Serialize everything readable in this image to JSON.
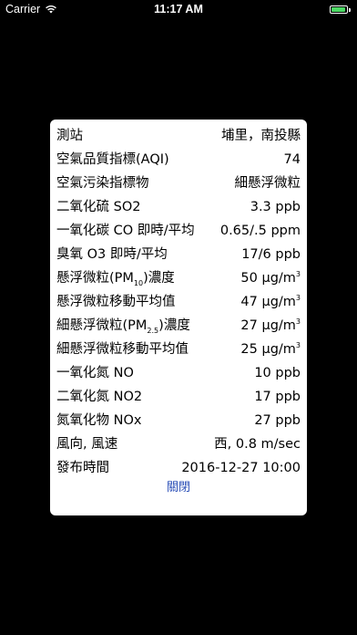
{
  "status_bar": {
    "carrier": "Carrier",
    "time": "11:17 AM",
    "battery_color": "#4cd964",
    "battery_level": 1.0
  },
  "dialog": {
    "rows": [
      {
        "label": "測站",
        "value": "埔里，南投縣"
      },
      {
        "label": "空氣品質指標(AQI)",
        "value": "74"
      },
      {
        "label": "空氣污染指標物",
        "value": "細懸浮微粒"
      },
      {
        "label": "二氧化硫 SO2",
        "value": "3.3 ppb"
      },
      {
        "label": "一氧化碳 CO 即時/平均",
        "value": "0.65/.5 ppm"
      },
      {
        "label": "臭氧 O3 即時/平均",
        "value": "17/6 ppb"
      },
      {
        "label_pre": "懸浮微粒(PM",
        "label_sub": "10",
        "label_post": ")濃度",
        "value_pre": "50 μg/m",
        "value_sup": "3"
      },
      {
        "label": "懸浮微粒移動平均值",
        "value_pre": "47 μg/m",
        "value_sup": "3"
      },
      {
        "label_pre": "細懸浮微粒(PM",
        "label_sub": "2.5",
        "label_post": ")濃度",
        "value_pre": "27 μg/m",
        "value_sup": "3"
      },
      {
        "label": "細懸浮微粒移動平均值",
        "value_pre": "25 μg/m",
        "value_sup": "3"
      },
      {
        "label": "一氧化氮 NO",
        "value": "10 ppb"
      },
      {
        "label": "二氧化氮 NO2",
        "value": "17 ppb"
      },
      {
        "label": "氮氧化物 NOx",
        "value": "27 ppb"
      },
      {
        "label": "風向, 風速",
        "value": "西, 0.8 m/sec"
      },
      {
        "label": "發布時間",
        "value": "2016-12-27 10:00"
      }
    ],
    "close_label": "關閉",
    "close_color": "#2b4fb7"
  }
}
